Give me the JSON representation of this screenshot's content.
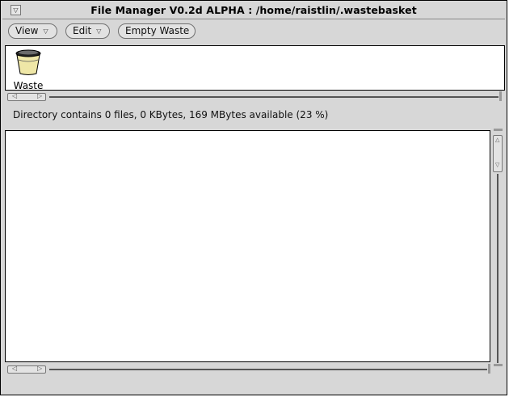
{
  "window": {
    "title": "File Manager V0.2d ALPHA : /home/raistlin/.wastebasket",
    "menu_glyph": "▽"
  },
  "toolbar": {
    "view_label": "View",
    "edit_label": "Edit",
    "empty_label": "Empty Waste",
    "arrow_glyph": "▽"
  },
  "icon_panel": {
    "items": [
      {
        "label": "Waste",
        "icon": "wastebasket-icon"
      }
    ]
  },
  "status": {
    "text": "Directory contains 0 files,   0 KBytes,   169 MBytes available (23 %)"
  },
  "scroll_glyphs": {
    "left": "◁",
    "right": "▷",
    "up": "△",
    "down": "▽"
  }
}
